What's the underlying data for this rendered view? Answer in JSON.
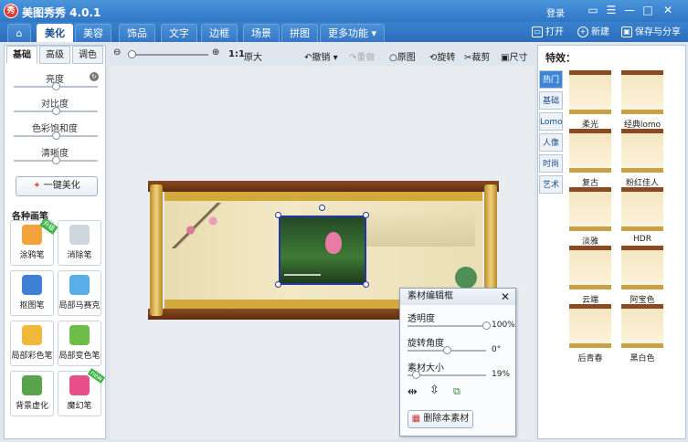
{
  "app": {
    "title": "美图秀秀 4.0.1",
    "logo": "秀",
    "login": "登录",
    "win": {
      "skin": "▭",
      "menu": "☰",
      "min": "—",
      "max": "□",
      "close": "✕"
    }
  },
  "tabs": [
    {
      "label": "美化"
    },
    {
      "label": "美容"
    },
    {
      "label": "饰品"
    },
    {
      "label": "文字"
    },
    {
      "label": "边框"
    },
    {
      "label": "场景"
    },
    {
      "label": "拼图"
    },
    {
      "label": "更多功能 ▾"
    }
  ],
  "top_actions": {
    "open": "打开",
    "new": "新建",
    "save": "保存与分享"
  },
  "left": {
    "subtabs": [
      "基础",
      "高级",
      "调色"
    ],
    "sliders": [
      {
        "label": "亮度",
        "value": 0.5
      },
      {
        "label": "对比度",
        "value": 0.5
      },
      {
        "label": "色彩饱和度",
        "value": 0.5
      },
      {
        "label": "清晰度",
        "value": 0.5
      }
    ],
    "one_key": "一键美化",
    "brush_title": "各种画笔",
    "tools": [
      {
        "label": "涂鸦笔",
        "color": "#f4a33c",
        "badge": "升级"
      },
      {
        "label": "消除笔",
        "color": "#d0d6dd",
        "badge": ""
      },
      {
        "label": "抠图笔",
        "color": "#3f7fd6",
        "badge": ""
      },
      {
        "label": "局部马赛克",
        "color": "#5aaee8",
        "badge": ""
      },
      {
        "label": "局部彩色笔",
        "color": "#f0b93c",
        "badge": ""
      },
      {
        "label": "局部变色笔",
        "color": "#6cbd4a",
        "badge": ""
      },
      {
        "label": "背景虚化",
        "color": "#58a54c",
        "badge": ""
      },
      {
        "label": "魔幻笔",
        "color": "#e74f88",
        "badge": "new"
      }
    ]
  },
  "toolbar": {
    "zoom_ratio": "1:1",
    "original_size": "原大",
    "undo": "撤销",
    "redo": "重做",
    "original": "原图",
    "rotate": "旋转",
    "crop": "裁剪",
    "size": "尺寸"
  },
  "right": {
    "title": "特效：",
    "tabs": [
      "热门",
      "基础",
      "Lomo",
      "人像",
      "时尚",
      "艺术"
    ],
    "effects": [
      "柔光",
      "经典lomo",
      "复古",
      "粉红佳人",
      "淡雅",
      "HDR",
      "云端",
      "阿宝色",
      "后青春",
      "黑白色"
    ]
  },
  "dialog": {
    "title": "素材编辑框",
    "close": "✕",
    "rows": [
      {
        "label": "透明度",
        "value": "100%",
        "fraction": 1.0
      },
      {
        "label": "旋转角度",
        "value": "0°",
        "fraction": 0.5
      },
      {
        "label": "素材大小",
        "value": "19%",
        "fraction": 0.1
      }
    ],
    "delete": "删除本素材"
  },
  "colors": {
    "accent": "#2f76c4",
    "frame": "#2435a8"
  }
}
